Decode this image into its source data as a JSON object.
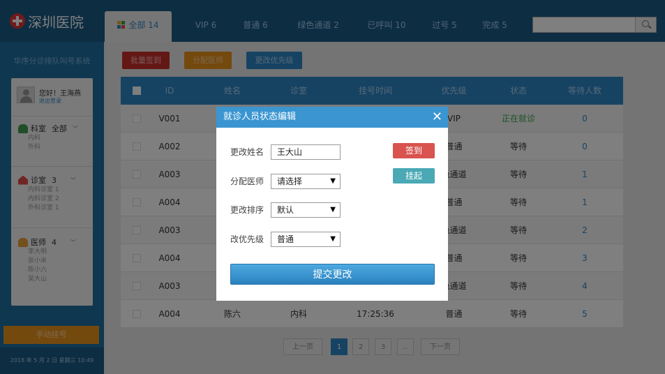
{
  "app": {
    "title": "深圳医院",
    "subtitle": "华序分诊排队叫号系统"
  },
  "user": {
    "greeting": "您好！王海燕",
    "logout": "退出登录"
  },
  "filters": {
    "dept": {
      "label": "科室",
      "value": "全部",
      "items": [
        "内科",
        "外科"
      ]
    },
    "room": {
      "label": "诊室",
      "value": "3",
      "items": [
        "内科诊室 1",
        "内科诊室 2",
        "外科诊室 1"
      ]
    },
    "doctor": {
      "label": "医师",
      "value": "4",
      "items": [
        "李大明",
        "张小米",
        "陈小六",
        "吴大山"
      ]
    }
  },
  "sidebar_buttons": {
    "manual": "手动挂号"
  },
  "datetime": "2018 年 5 月 2 日  星期三  10:49",
  "tabs": [
    "全部 14",
    "VIP 6",
    "普通 6",
    "绿色通道 2",
    "已呼叫 10",
    "过号 5",
    "完成 5"
  ],
  "search": {
    "placeholder": ""
  },
  "actions": {
    "batch_checkin": "批量签到",
    "assign_doctor": "分配医师",
    "change_priority": "更改优先级"
  },
  "table": {
    "headers": [
      "ID",
      "姓名",
      "诊室",
      "挂号时间",
      "优先级",
      "状态",
      "等待人数"
    ],
    "rows": [
      {
        "id": "V001",
        "name": "",
        "room": "",
        "time": "",
        "priority": "VIP",
        "status": "正在就诊",
        "wait": "0"
      },
      {
        "id": "A002",
        "name": "",
        "room": "",
        "time": "",
        "priority": "普通",
        "status": "等待",
        "wait": "0"
      },
      {
        "id": "A003",
        "name": "",
        "room": "",
        "time": "",
        "priority": "色通道",
        "status": "等待",
        "wait": "1"
      },
      {
        "id": "A004",
        "name": "",
        "room": "",
        "time": "",
        "priority": "普通",
        "status": "等待",
        "wait": "1"
      },
      {
        "id": "A003",
        "name": "",
        "room": "",
        "time": "",
        "priority": "色通道",
        "status": "等待",
        "wait": "2"
      },
      {
        "id": "A004",
        "name": "",
        "room": "",
        "time": "",
        "priority": "普通",
        "status": "等待",
        "wait": "3"
      },
      {
        "id": "A003",
        "name": "",
        "room": "",
        "time": "",
        "priority": "色通道",
        "status": "等待",
        "wait": "4"
      },
      {
        "id": "A004",
        "name": "陈六",
        "room": "内科",
        "time": "17:25:36",
        "priority": "普通",
        "status": "等待",
        "wait": "5"
      }
    ]
  },
  "pagination": {
    "prev": "上一页",
    "pages": [
      "1",
      "2",
      "3"
    ],
    "ellipsis": "...",
    "next": "下一页"
  },
  "modal": {
    "title": "就诊人员状态编辑",
    "close": "✕",
    "name_label": "更改姓名",
    "name_value": "王大山",
    "doctor_label": "分配医师",
    "doctor_value": "请选择",
    "order_label": "更改排序",
    "order_value": "默认",
    "priority_label": "改优先级",
    "priority_value": "普通",
    "checkin": "签到",
    "hold": "挂起",
    "submit": "提交更改"
  },
  "colors": {
    "primary": "#2e87c6",
    "header": "#1a5a86",
    "danger": "#d9534f",
    "teal": "#4aa9b5",
    "orange": "#e8931c",
    "green": "#3aa34a"
  }
}
